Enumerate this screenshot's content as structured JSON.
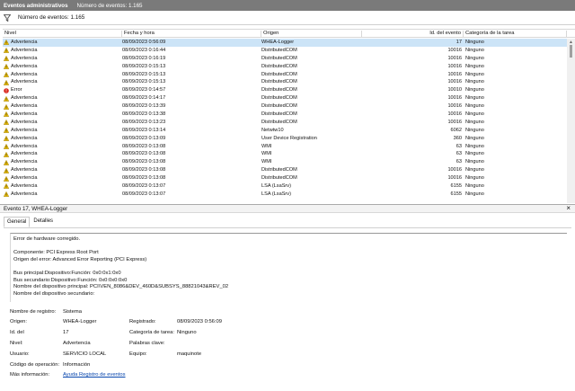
{
  "header": {
    "title": "Eventos administrativos",
    "count": "Número de eventos: 1.165"
  },
  "filterbar": {
    "label": "Número de eventos: 1.165"
  },
  "columns": [
    "Nivel",
    "Fecha y hora",
    "Origen",
    "Id. del evento",
    "Categoría de la tarea"
  ],
  "events": [
    {
      "level": "Advertencia",
      "type": "warning",
      "date": "08/09/2023 0:56:09",
      "source": "WHEA-Logger",
      "id": "17",
      "category": "Ninguno"
    },
    {
      "level": "Advertencia",
      "type": "warning",
      "date": "08/09/2023 0:16:44",
      "source": "DistributedCOM",
      "id": "10016",
      "category": "Ninguno"
    },
    {
      "level": "Advertencia",
      "type": "warning",
      "date": "08/09/2023 0:16:19",
      "source": "DistributedCOM",
      "id": "10016",
      "category": "Ninguno"
    },
    {
      "level": "Advertencia",
      "type": "warning",
      "date": "08/09/2023 0:15:13",
      "source": "DistributedCOM",
      "id": "10016",
      "category": "Ninguno"
    },
    {
      "level": "Advertencia",
      "type": "warning",
      "date": "08/09/2023 0:15:13",
      "source": "DistributedCOM",
      "id": "10016",
      "category": "Ninguno"
    },
    {
      "level": "Advertencia",
      "type": "warning",
      "date": "08/09/2023 0:15:13",
      "source": "DistributedCOM",
      "id": "10016",
      "category": "Ninguno"
    },
    {
      "level": "Error",
      "type": "error",
      "date": "08/09/2023 0:14:57",
      "source": "DistributedCOM",
      "id": "10010",
      "category": "Ninguno"
    },
    {
      "level": "Advertencia",
      "type": "warning",
      "date": "08/09/2023 0:14:17",
      "source": "DistributedCOM",
      "id": "10016",
      "category": "Ninguno"
    },
    {
      "level": "Advertencia",
      "type": "warning",
      "date": "08/09/2023 0:13:39",
      "source": "DistributedCOM",
      "id": "10016",
      "category": "Ninguno"
    },
    {
      "level": "Advertencia",
      "type": "warning",
      "date": "08/09/2023 0:13:38",
      "source": "DistributedCOM",
      "id": "10016",
      "category": "Ninguno"
    },
    {
      "level": "Advertencia",
      "type": "warning",
      "date": "08/09/2023 0:13:23",
      "source": "DistributedCOM",
      "id": "10016",
      "category": "Ninguno"
    },
    {
      "level": "Advertencia",
      "type": "warning",
      "date": "08/09/2023 0:13:14",
      "source": "Netwtw10",
      "id": "6062",
      "category": "Ninguno"
    },
    {
      "level": "Advertencia",
      "type": "warning",
      "date": "08/09/2023 0:13:09",
      "source": "User Device Registration",
      "id": "360",
      "category": "Ninguno"
    },
    {
      "level": "Advertencia",
      "type": "warning",
      "date": "08/09/2023 0:13:08",
      "source": "WMI",
      "id": "63",
      "category": "Ninguno"
    },
    {
      "level": "Advertencia",
      "type": "warning",
      "date": "08/09/2023 0:13:08",
      "source": "WMI",
      "id": "63",
      "category": "Ninguno"
    },
    {
      "level": "Advertencia",
      "type": "warning",
      "date": "08/09/2023 0:13:08",
      "source": "WMI",
      "id": "63",
      "category": "Ninguno"
    },
    {
      "level": "Advertencia",
      "type": "warning",
      "date": "08/09/2023 0:13:08",
      "source": "DistributedCOM",
      "id": "10016",
      "category": "Ninguno"
    },
    {
      "level": "Advertencia",
      "type": "warning",
      "date": "08/09/2023 0:13:08",
      "source": "DistributedCOM",
      "id": "10016",
      "category": "Ninguno"
    },
    {
      "level": "Advertencia",
      "type": "warning",
      "date": "08/09/2023 0:13:07",
      "source": "LSA (LsaSrv)",
      "id": "6155",
      "category": "Ninguno"
    },
    {
      "level": "Advertencia",
      "type": "warning",
      "date": "08/09/2023 0:13:07",
      "source": "LSA (LsaSrv)",
      "id": "6155",
      "category": "Ninguno"
    }
  ],
  "detail": {
    "title": "Evento 17, WHEA-Logger",
    "close": "×",
    "tabs": [
      "General",
      "Detalles"
    ],
    "description": [
      "Error de hardware corregido.",
      "",
      "Componente: PCI Express Root Port",
      "Origen del error: Advanced Error Reporting (PCI Express)",
      "",
      "Bus principal:Dispositivo:Función: 0x0:0x1:0x0",
      "Bus secundario:Dispositivo:Función: 0x0:0x0:0x0",
      "Nombre del dispositivo principal: PCI\\VEN_8086&DEV_460D&SUBSYS_88821043&REV_02",
      "Nombre del dispositivo secundario:"
    ],
    "props": {
      "log_name_label": "Nombre de registro:",
      "log_name": "Sistema",
      "source_label": "Origen:",
      "source": "WHEA-Logger",
      "registered_label": "Registrado:",
      "registered": "08/09/2023 0:56:09",
      "id_label": "Id. del",
      "id": "17",
      "task_label": "Categoría de tarea:",
      "task": "Ninguno",
      "level_label": "Nivel:",
      "level": "Advertencia",
      "keywords_label": "Palabras clave:",
      "keywords": "",
      "user_label": "Usuario:",
      "user": "SERVICIO LOCAL",
      "computer_label": "Equipo:",
      "computer": "maquinote",
      "opcode_label": "Código de operación:",
      "opcode": "Información",
      "more_label": "Más información:",
      "more_link": "Ayuda Registro de eventos"
    }
  }
}
